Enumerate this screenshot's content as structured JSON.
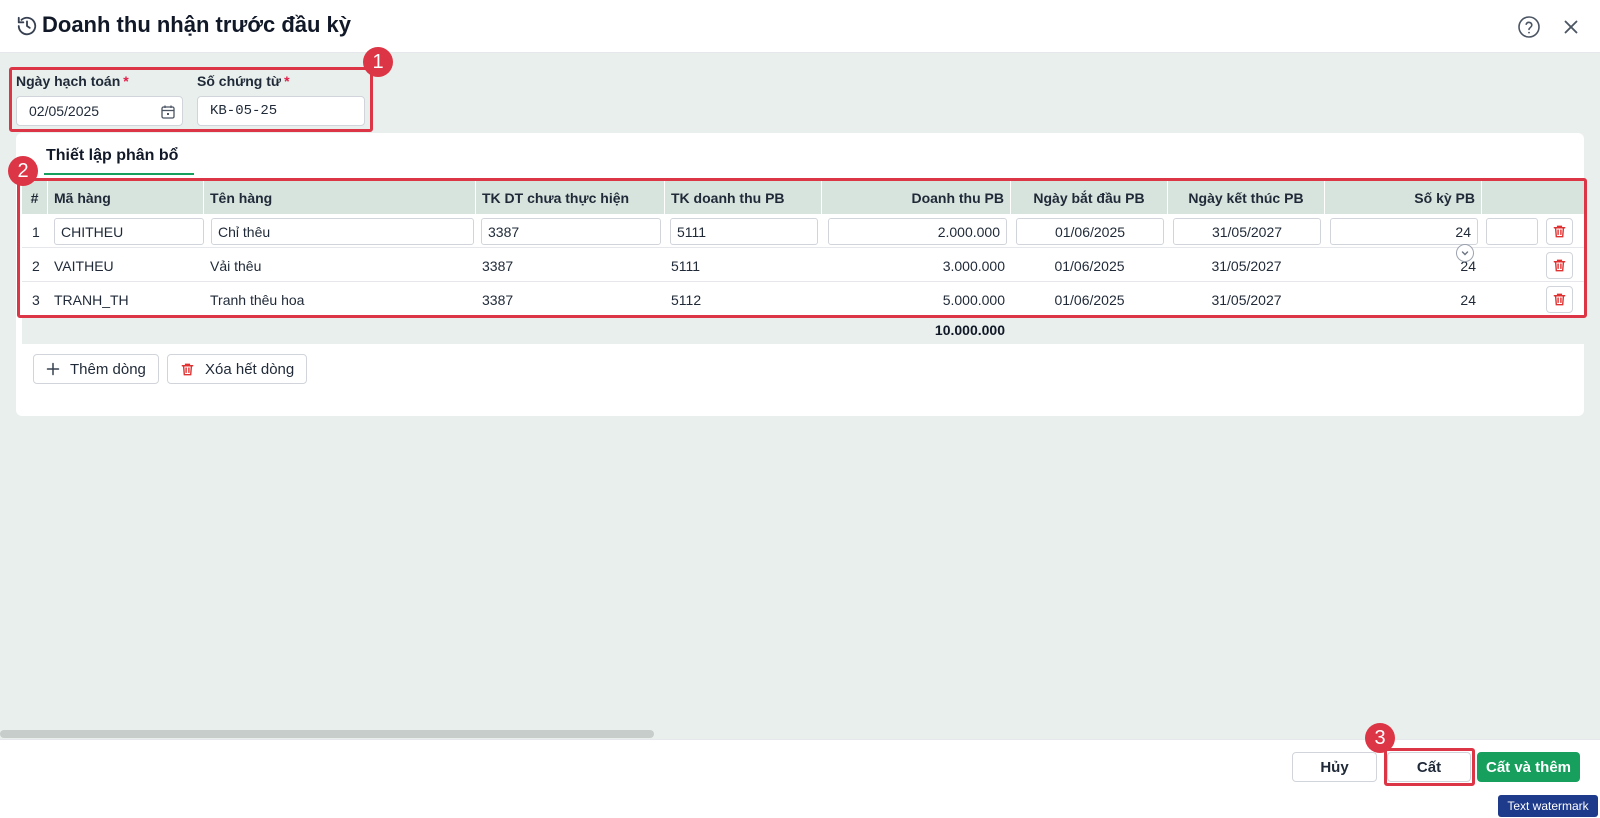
{
  "dialog": {
    "title": "Doanh thu nhận trước đầu kỳ",
    "icons": {
      "history": "history-icon",
      "help": "help-icon",
      "close": "close-icon"
    }
  },
  "form": {
    "posting_date": {
      "label": "Ngày hạch toán",
      "required_mark": "*",
      "value": "02/05/2025",
      "icon": "calendar-icon"
    },
    "voucher_no": {
      "label": "Số chứng từ",
      "required_mark": "*",
      "value": "KB-05-25"
    }
  },
  "tab": {
    "label": "Thiết lập phân bổ"
  },
  "table": {
    "columns": [
      "#",
      "Mã hàng",
      "Tên hàng",
      "TK DT chưa thực hiện",
      "TK doanh thu PB",
      "Doanh thu PB",
      "Ngày bắt đầu PB",
      "Ngày kết thúc PB",
      "Số kỳ PB"
    ],
    "rows": [
      {
        "no": "1",
        "code": "CHITHEU",
        "name": "Chỉ thêu",
        "unrealized_acct": "3387",
        "revenue_acct": "5111",
        "amount": "2.000.000",
        "start": "01/06/2025",
        "end": "31/05/2027",
        "periods": "24"
      },
      {
        "no": "2",
        "code": "VAITHEU",
        "name": "Vải thêu",
        "unrealized_acct": "3387",
        "revenue_acct": "5111",
        "amount": "3.000.000",
        "start": "01/06/2025",
        "end": "31/05/2027",
        "periods": "24"
      },
      {
        "no": "3",
        "code": "TRANH_TH",
        "name": "Tranh thêu hoa",
        "unrealized_acct": "3387",
        "revenue_acct": "5112",
        "amount": "5.000.000",
        "start": "01/06/2025",
        "end": "31/05/2027",
        "periods": "24"
      }
    ],
    "total_amount": "10.000.000"
  },
  "actions": {
    "add_row": "Thêm dòng",
    "delete_all": "Xóa hết dòng"
  },
  "footer": {
    "cancel": "Hủy",
    "save": "Cất",
    "save_and_add": "Cất và thêm"
  },
  "annotations": [
    "1",
    "2",
    "3"
  ],
  "watermark": "Text watermark",
  "colors": {
    "primary": "#17a05d",
    "callout": "#dc3545",
    "danger": "#e03131",
    "body_bg": "#e8efec",
    "table_head": "#d7e3dd"
  }
}
